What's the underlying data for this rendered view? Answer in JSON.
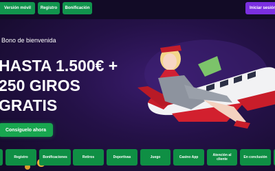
{
  "header": {
    "version_movil": "Versión móvil",
    "registro": "Registro",
    "bonificacion": "Bonificación",
    "login": "Iniciar sesión"
  },
  "hero": {
    "welcome": "Bono de bienvenida",
    "headline_line1": "HASTA 1.500€ +",
    "headline_line2": "250 GIROS",
    "headline_line3": "GRATIS",
    "cta": "Consíguelo ahora"
  },
  "bottom_nav": {
    "tabs": [
      {
        "label": ""
      },
      {
        "label": "Registro"
      },
      {
        "label": "Bonificaciones"
      },
      {
        "label": "Retiros"
      },
      {
        "label": "Deportivas"
      },
      {
        "label": "Juego"
      },
      {
        "label": "Casino App"
      },
      {
        "label": "Atención al cliente"
      },
      {
        "label": "En conclusión"
      },
      {
        "label": ""
      }
    ]
  },
  "colors": {
    "accent_green": "#11944d",
    "login_purple": "#7b2fe0",
    "background": "#150d2b"
  }
}
